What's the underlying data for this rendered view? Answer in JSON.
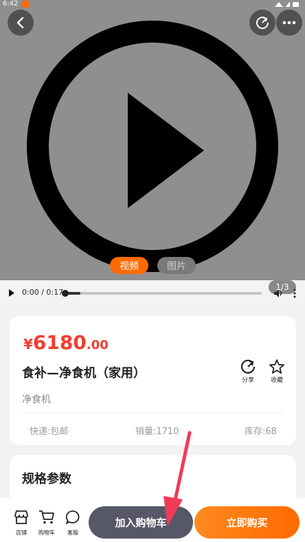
{
  "status_bar": {
    "time": "6:42"
  },
  "media": {
    "tabs": [
      {
        "label": "视频",
        "active": true
      },
      {
        "label": "图片",
        "active": false
      }
    ],
    "counter": "1/3",
    "video": {
      "timecode": "0:00 / 0:17",
      "progress": 0.08
    }
  },
  "product": {
    "currency": "¥",
    "price_int": "6180",
    "price_dec": ".00",
    "title": "食补—净食机（家用）",
    "subtitle": "净食机",
    "share_label": "分享",
    "favorite_label": "收藏",
    "shipping": "快递:包邮",
    "sales": "销量:1710",
    "stock": "库存:68"
  },
  "specs": {
    "heading": "规格参数"
  },
  "bottom_bar": {
    "shop_label": "店铺",
    "cart_label": "购物车",
    "service_label": "客服",
    "add_to_cart": "加入购物车",
    "buy_now": "立即购买"
  },
  "colors": {
    "price": "#f03d2d",
    "accent": "#ff6a00",
    "cart_button": "#565868"
  }
}
